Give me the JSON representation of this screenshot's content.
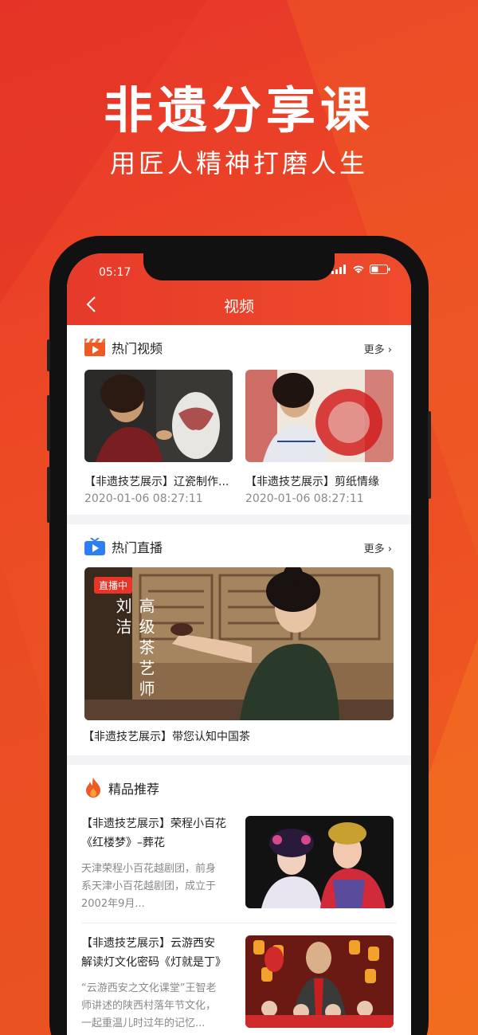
{
  "promo": {
    "headline": "非遗分享课",
    "subline": "用匠人精神打磨人生"
  },
  "status": {
    "time": "05:17"
  },
  "nav": {
    "title": "视频"
  },
  "hot_videos": {
    "title": "热门视频",
    "more": "更多 ›",
    "items": [
      {
        "title": "【非遗技艺展示】辽瓷制作...",
        "date": "2020-01-06 08:27:11"
      },
      {
        "title": "【非遗技艺展示】剪纸情缘",
        "date": "2020-01-06 08:27:11"
      }
    ]
  },
  "hot_live": {
    "title": "热门直播",
    "more": "更多 ›",
    "badge": "直播中",
    "overlay_text": "高级茶艺师刘洁",
    "caption": "【非遗技艺展示】带您认知中国茶"
  },
  "recommend": {
    "title": "精品推荐",
    "items": [
      {
        "title_line1": "【非遗技艺展示】荣程小百花",
        "title_line2": "《红楼梦》–葬花",
        "desc_line1": "天津荣程小百花越剧团，前身",
        "desc_line2": "系天津小百花越剧团，成立于",
        "desc_line3": "2002年9月..."
      },
      {
        "title_line1": "【非遗技艺展示】云游西安",
        "title_line2": "解读灯文化密码《灯就是丁》",
        "desc_line1": "“云游西安之文化课堂”王智老",
        "desc_line2": "师讲述的陕西村落年节文化，",
        "desc_line3": "一起重温儿时过年的记忆..."
      }
    ]
  },
  "colors": {
    "brand": "#e8362a",
    "accent_orange": "#f0601f"
  }
}
